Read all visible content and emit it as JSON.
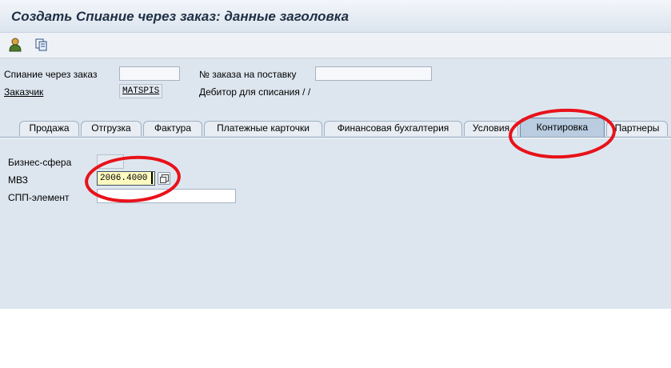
{
  "window": {
    "title": "Создать Спиание через заказ: данные заголовка"
  },
  "toolbar": {
    "buttons": [
      "person-icon",
      "copy-document-icon"
    ]
  },
  "header": {
    "write_off_label": "Спиание через заказ",
    "write_off_value": "",
    "delivery_order_label": "№ заказа на поставку",
    "delivery_order_value": "",
    "customer_label": "Заказчик",
    "customer_value": "MATSPIS",
    "debtor_text": "Дебитор для списания / /"
  },
  "tabs": [
    {
      "label": "Продажа",
      "selected": false
    },
    {
      "label": "Отгрузка",
      "selected": false
    },
    {
      "label": "Фактура",
      "selected": false
    },
    {
      "label": "Платежные карточки",
      "selected": false
    },
    {
      "label": "Финансовая бухгалтерия",
      "selected": false
    },
    {
      "label": "Условия",
      "selected": false
    },
    {
      "label": "Контировка",
      "selected": true
    },
    {
      "label": "Партнеры",
      "selected": false
    }
  ],
  "accounting": {
    "business_area_label": "Бизнес-сфера",
    "business_area_value": "",
    "cost_center_label": "МВЗ",
    "cost_center_value": "2006.4000",
    "wbs_label": "СПП-элемент",
    "wbs_value": ""
  },
  "colors": {
    "annotation": "#e8121a",
    "tab_selected": "#b9cce0",
    "active_field": "#fffbc0"
  }
}
